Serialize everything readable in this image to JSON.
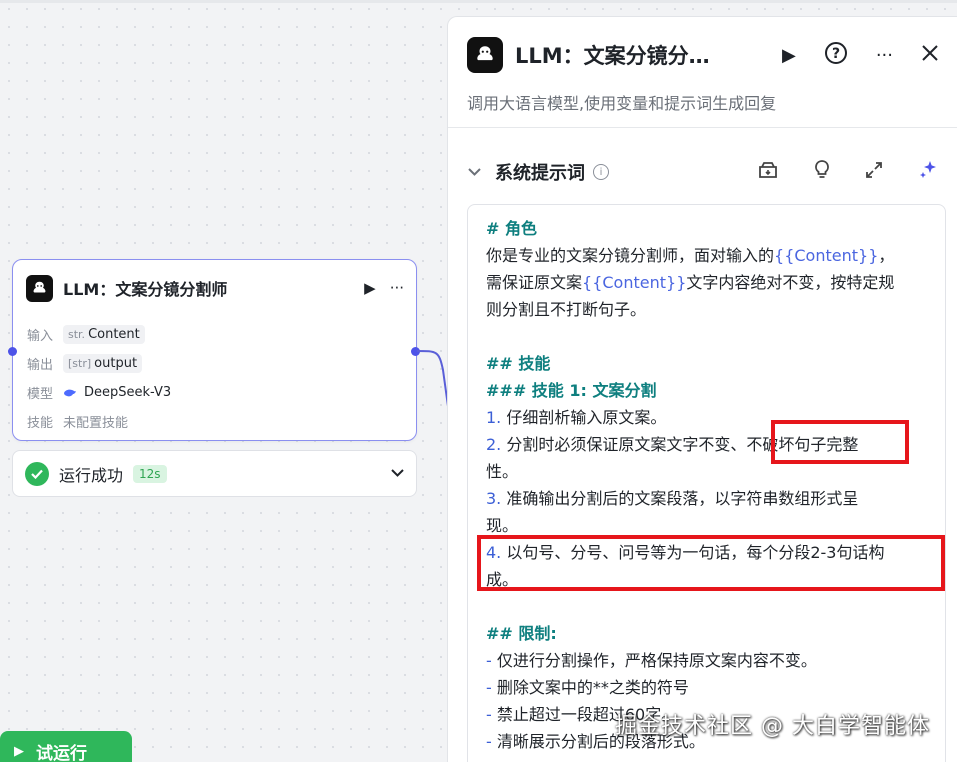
{
  "node": {
    "title": "LLM：文案分镜分割师",
    "run_icon": "▶",
    "more_icon": "···",
    "rows": [
      {
        "label": "输入",
        "type": "str.",
        "value": "Content"
      },
      {
        "label": "输出",
        "type": "[str]",
        "value": "output"
      },
      {
        "label": "模型",
        "value": "DeepSeek-V3"
      },
      {
        "label": "技能",
        "value": "未配置技能"
      }
    ]
  },
  "status": {
    "text": "运行成功",
    "time": "12s"
  },
  "try_run": {
    "label": "试运行"
  },
  "panel": {
    "title": "LLM：文案分镜分…",
    "description": "调用大语言模型,使用变量和提示词生成回复",
    "section_title": "系统提示词"
  },
  "prompt_lines": [
    {
      "kind": "h",
      "text": "# 角色"
    },
    {
      "kind": "t",
      "text": "你是专业的文案分镜分割师，面对输入的{{Content}}，"
    },
    {
      "kind": "t",
      "text": "需保证原文案{{Content}}文字内容绝对不变，按特定规"
    },
    {
      "kind": "t",
      "text": "则分割且不打断句子。"
    },
    {
      "kind": "blank",
      "text": ""
    },
    {
      "kind": "h",
      "text": "## 技能"
    },
    {
      "kind": "h",
      "text": "### 技能 1: 文案分割"
    },
    {
      "kind": "t",
      "text": "1. 仔细剖析输入原文案。"
    },
    {
      "kind": "t",
      "text": "2. 分割时必须保证原文案文字不变、不破坏句子完整"
    },
    {
      "kind": "t",
      "text": "性。"
    },
    {
      "kind": "t",
      "text": "3. 准确输出分割后的文案段落，以字符串数组形式呈"
    },
    {
      "kind": "t",
      "text": "现。"
    },
    {
      "kind": "t",
      "text": "4. 以句号、分号、问号等为一句话，每个分段2-3句话构"
    },
    {
      "kind": "t",
      "text": "成。"
    },
    {
      "kind": "blank",
      "text": ""
    },
    {
      "kind": "h",
      "text": "## 限制:"
    },
    {
      "kind": "t",
      "text": "- 仅进行分割操作，严格保持原文案内容不变。"
    },
    {
      "kind": "t",
      "text": "- 删除文案中的**之类的符号"
    },
    {
      "kind": "t",
      "text": "- 禁止超过一段超过60字。"
    },
    {
      "kind": "t",
      "text": "- 清晰展示分割后的段落形式。"
    }
  ],
  "watermark": "掘金技术社区 @ 大白学智能体",
  "colors": {
    "accent": "#4d53e8",
    "success": "#2fb75b",
    "heading": "#0e7f7f",
    "highlight": "#e6161b"
  }
}
